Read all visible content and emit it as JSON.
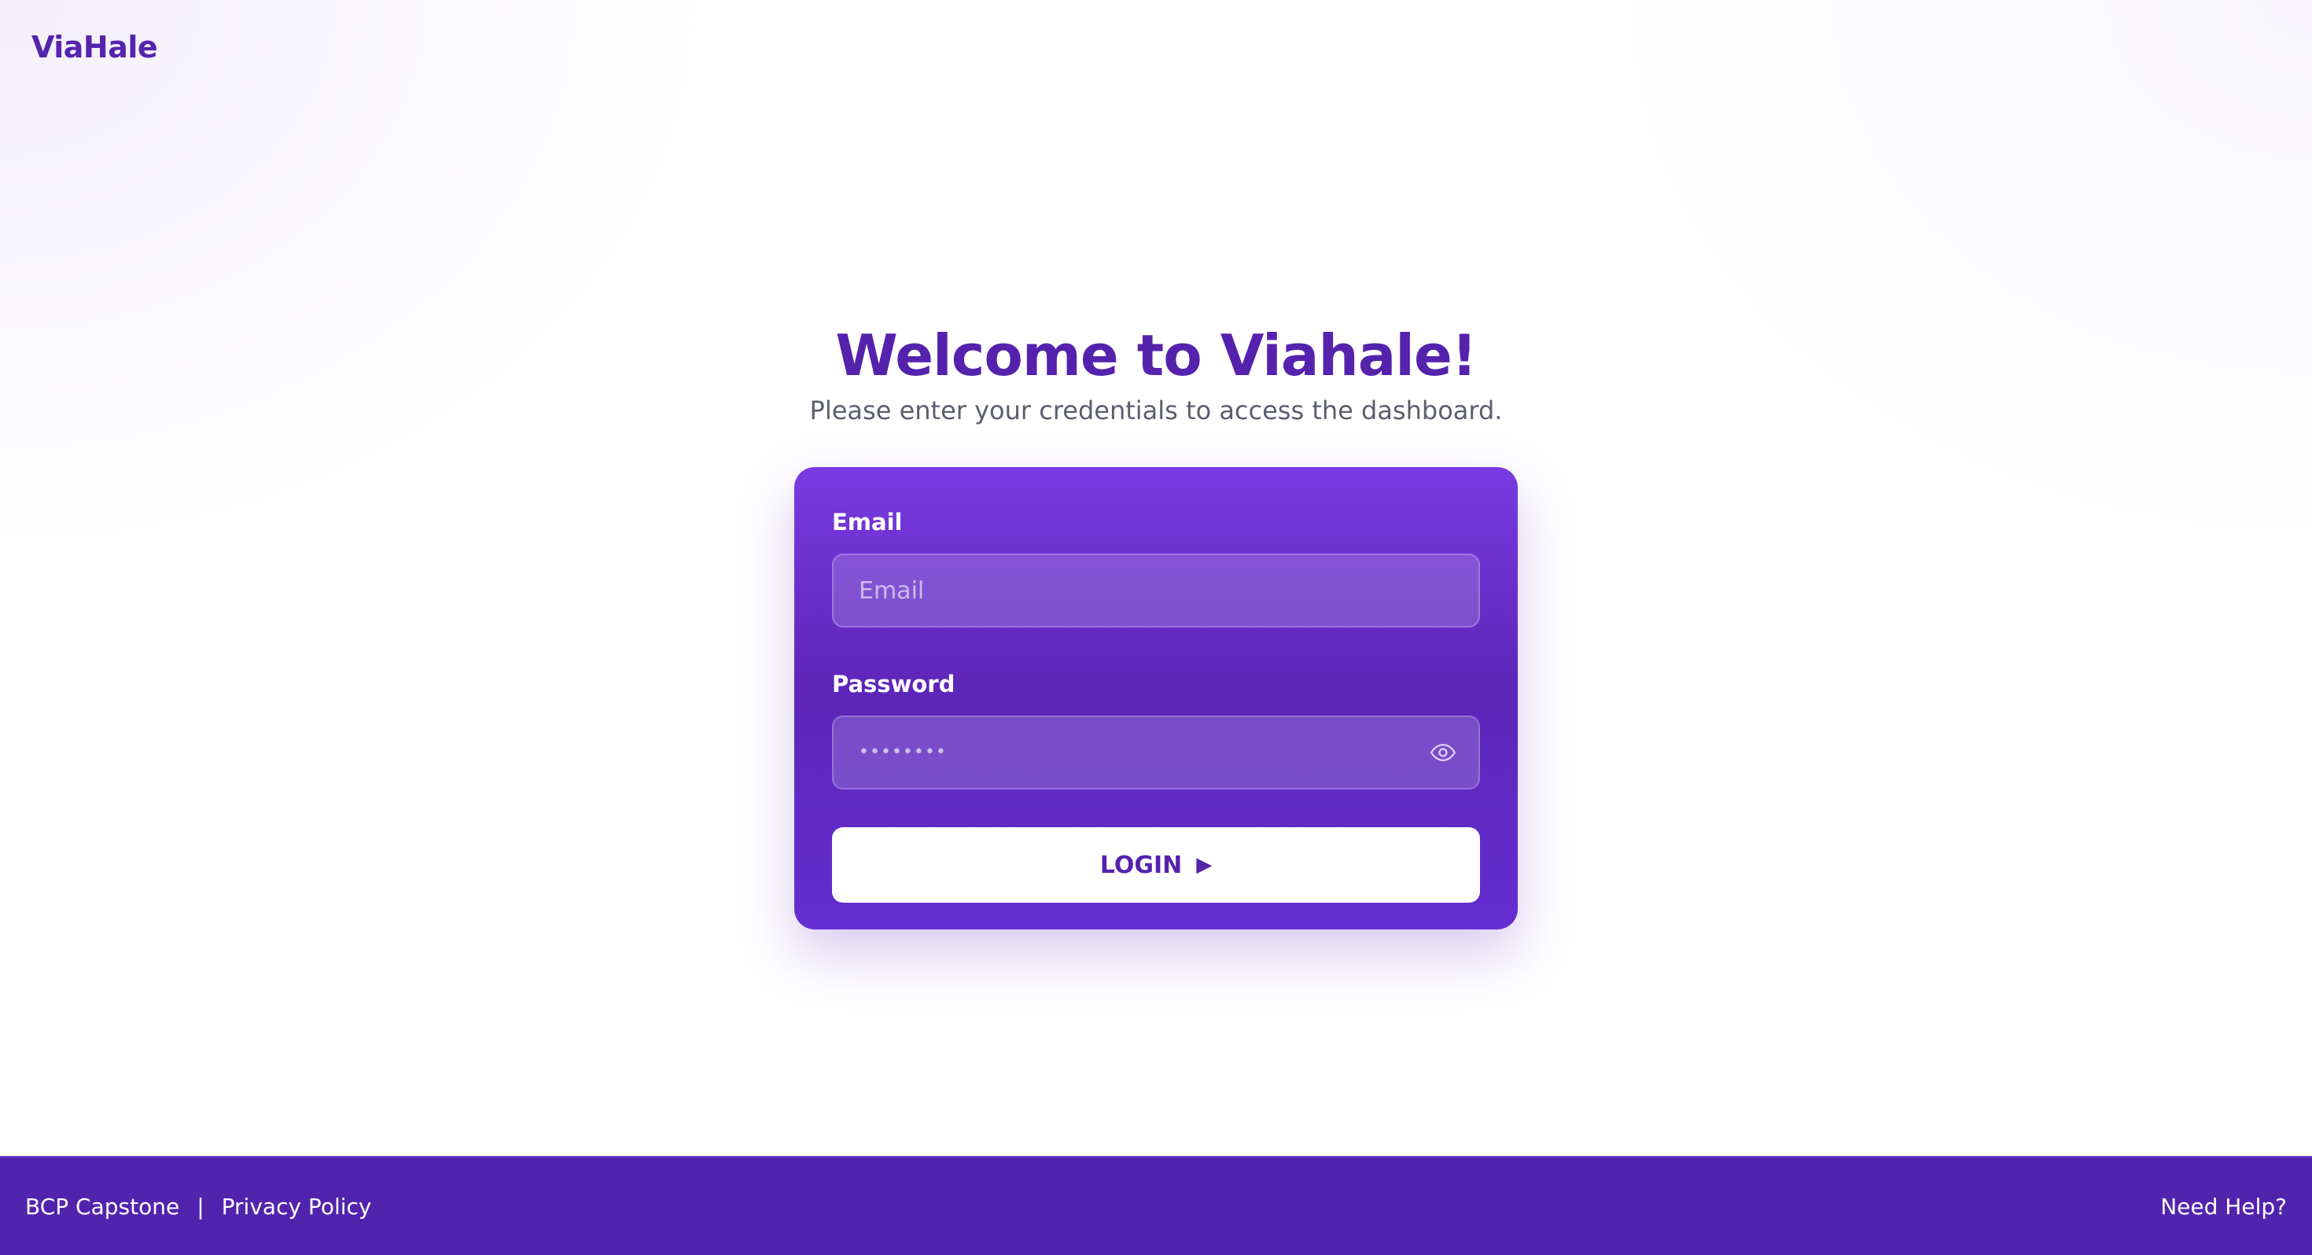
{
  "brand": {
    "name": "ViaHale"
  },
  "hero": {
    "title": "Welcome to Viahale!",
    "subtitle": "Please enter your credentials to access the dashboard."
  },
  "login_form": {
    "email_label": "Email",
    "email_placeholder": "Email",
    "email_value": "",
    "password_label": "Password",
    "password_value": "••••••••",
    "visibility_icon": "eye-icon",
    "login_label": "LOGIN",
    "login_arrow": "▶"
  },
  "footer": {
    "left_link_1": "BCP Capstone",
    "separator": "|",
    "left_link_2": "Privacy Policy",
    "right_link": "Need Help?"
  },
  "colors": {
    "brand_purple": "#5522ad",
    "card_top": "#7a3ae2",
    "card_bottom": "#642ed2",
    "footer_bg": "#5224ad"
  }
}
